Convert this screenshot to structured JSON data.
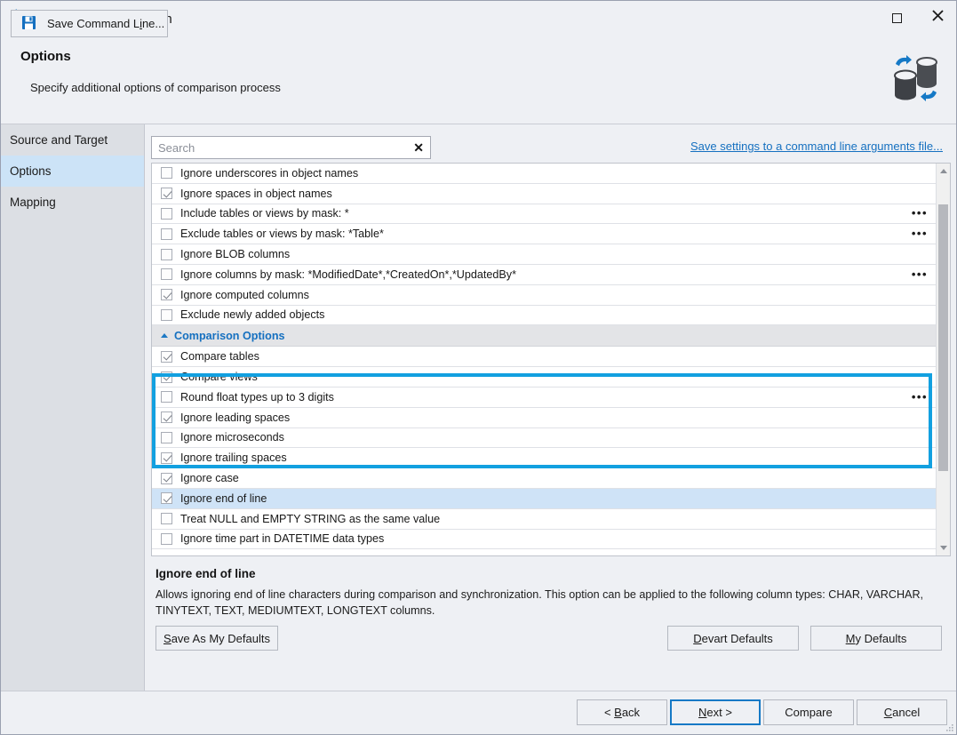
{
  "window": {
    "title": "New Data Comparison",
    "icon": "database-compare-icon",
    "maximize_label": "Maximize",
    "close_label": "Close"
  },
  "header": {
    "title": "Options",
    "subtitle": "Specify additional options of comparison process",
    "logo": "database-sync-logo"
  },
  "sidebar": {
    "items": [
      {
        "label": "Source and Target",
        "active": false
      },
      {
        "label": "Options",
        "active": true
      },
      {
        "label": "Mapping",
        "active": false
      }
    ]
  },
  "search": {
    "placeholder": "Search",
    "value": "",
    "clear_label": "✕"
  },
  "save_settings_link": "Save settings to a command line arguments file...",
  "options_list": [
    {
      "label": "Ignore underscores in object names",
      "checked": false,
      "ellipsis": false,
      "group": false,
      "selected": false
    },
    {
      "label": "Ignore spaces in object names",
      "checked": true,
      "ellipsis": false,
      "group": false,
      "selected": false
    },
    {
      "label": "Include tables or views by mask: *",
      "checked": false,
      "ellipsis": true,
      "group": false,
      "selected": false
    },
    {
      "label": "Exclude tables or views by mask: *Table*",
      "checked": false,
      "ellipsis": true,
      "group": false,
      "selected": false
    },
    {
      "label": "Ignore BLOB columns",
      "checked": false,
      "ellipsis": false,
      "group": false,
      "selected": false
    },
    {
      "label": "Ignore columns by mask: *ModifiedDate*,*CreatedOn*,*UpdatedBy*",
      "checked": false,
      "ellipsis": true,
      "group": false,
      "selected": false
    },
    {
      "label": "Ignore computed columns",
      "checked": true,
      "ellipsis": false,
      "group": false,
      "selected": false
    },
    {
      "label": "Exclude newly added objects",
      "checked": false,
      "ellipsis": false,
      "group": false,
      "selected": false
    },
    {
      "label": "Comparison Options",
      "group": true
    },
    {
      "label": "Compare tables",
      "checked": true,
      "ellipsis": false,
      "group": false,
      "selected": false
    },
    {
      "label": "Compare views",
      "checked": true,
      "ellipsis": false,
      "group": false,
      "selected": false
    },
    {
      "label": "Round float types up to 3 digits",
      "checked": false,
      "ellipsis": true,
      "group": false,
      "selected": false
    },
    {
      "label": "Ignore leading spaces",
      "checked": true,
      "ellipsis": false,
      "group": false,
      "selected": false
    },
    {
      "label": "Ignore microseconds",
      "checked": false,
      "ellipsis": false,
      "group": false,
      "selected": false
    },
    {
      "label": "Ignore trailing spaces",
      "checked": true,
      "ellipsis": false,
      "group": false,
      "selected": false
    },
    {
      "label": "Ignore case",
      "checked": true,
      "ellipsis": false,
      "group": false,
      "selected": false
    },
    {
      "label": "Ignore end of line",
      "checked": true,
      "ellipsis": false,
      "group": false,
      "selected": true
    },
    {
      "label": "Treat NULL and EMPTY STRING as the same value",
      "checked": false,
      "ellipsis": false,
      "group": false,
      "selected": false
    },
    {
      "label": "Ignore time part in DATETIME data types",
      "checked": false,
      "ellipsis": false,
      "group": false,
      "selected": false
    }
  ],
  "highlight": {
    "color": "#12a0e0",
    "first_row": "Ignore leading spaces",
    "last_row": "Ignore end of line"
  },
  "description": {
    "title": "Ignore end of line",
    "body": "Allows ignoring end of line characters during comparison and synchronization. This option can be applied to the following column types: CHAR, VARCHAR, TINYTEXT, TEXT, MEDIUMTEXT, LONGTEXT columns."
  },
  "defaults_buttons": {
    "save_as_my_defaults": {
      "pre": "S",
      "post": "ave As My Defaults"
    },
    "devart_defaults": {
      "pre": "D",
      "post": "evart Defaults"
    },
    "my_defaults": {
      "pre": "M",
      "post": "y Defaults"
    }
  },
  "footer": {
    "save_command_line": {
      "pre": "Save Command L",
      "mid": "i",
      "post": "ne..."
    },
    "save_icon": "floppy-save-icon",
    "back": {
      "pre": "< ",
      "mid": "B",
      "post": "ack"
    },
    "next": {
      "pre": "",
      "mid": "N",
      "post": "ext >"
    },
    "compare": {
      "pre": "",
      "mid": "C",
      "post": "ompare"
    },
    "cancel": {
      "pre": "",
      "mid": "C",
      "post": "ancel"
    }
  },
  "colors": {
    "accent_blue": "#1570c0",
    "highlight_blue": "#12a0e0",
    "selection_blue": "#cfe3f7",
    "window_bg": "#eef0f4",
    "sidebar_bg": "#dcdfe4"
  }
}
